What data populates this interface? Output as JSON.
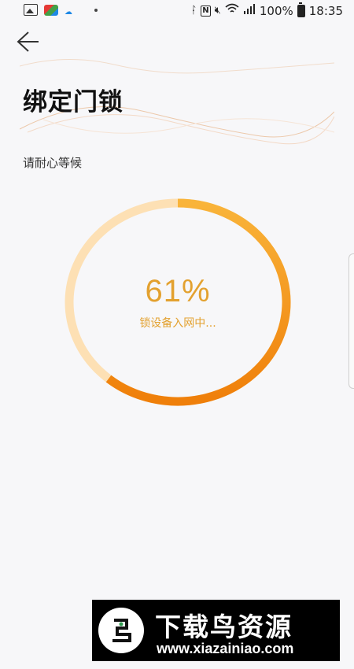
{
  "status_bar": {
    "battery": "100%",
    "time": "18:35"
  },
  "header": {
    "title": "绑定门锁",
    "subtitle": "请耐心等候"
  },
  "progress": {
    "percent_value": 0.61,
    "percent_label": "61%",
    "status_text": "锁设备入网中...",
    "colors": {
      "track": "#fde0b4",
      "fill_start": "#f9b43a",
      "fill_end": "#ef7f0a",
      "text": "#e3a12f"
    }
  },
  "watermark": {
    "title": "下载鸟资源",
    "url": "www.xiazainiao.com"
  }
}
